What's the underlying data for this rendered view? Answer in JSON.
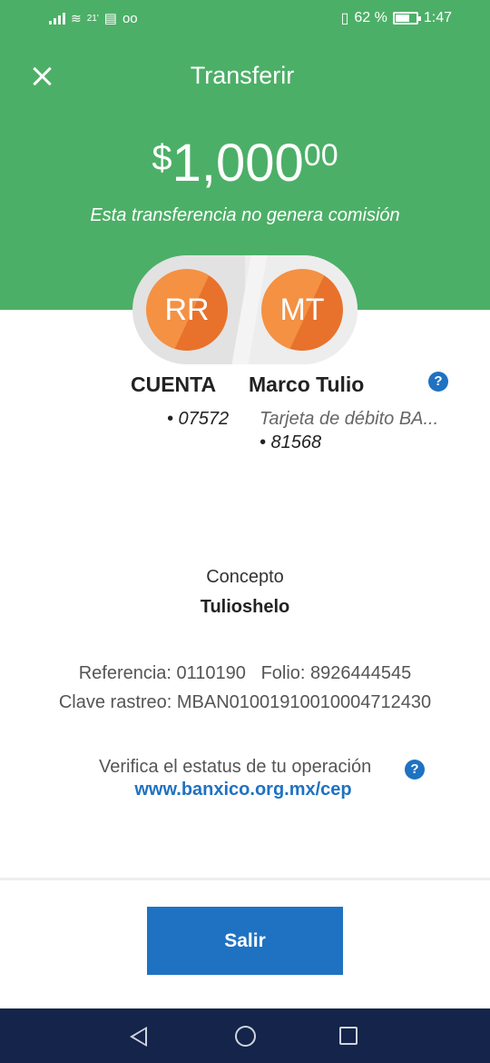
{
  "status_bar": {
    "left_small_text": "21'",
    "battery_percent": "62 %",
    "battery_level": 0.62,
    "time": "1:47",
    "icons": [
      "signal-icon",
      "wifi-icon",
      "message-icon",
      "voicemail-icon",
      "vibrate-icon",
      "battery-icon"
    ]
  },
  "header": {
    "title": "Transferir",
    "amount_currency": "$",
    "amount_main": "1,000",
    "amount_cents": "00",
    "subtitle": "Esta transferencia no genera comisión"
  },
  "from": {
    "initials": "RR",
    "label": "CUENTA",
    "account": "• 07572"
  },
  "to": {
    "initials": "MT",
    "name": "Marco Tulio",
    "account_type": "Tarjeta de débito BA...",
    "account": "• 81568"
  },
  "help_icon": "?",
  "concept": {
    "label": "Concepto",
    "value": "Tulioshelo"
  },
  "details": {
    "referencia_line": "Referencia: 0110190   Folio: 8926444545",
    "clave_line": "Clave rastreo: MBAN01001910010004712430"
  },
  "verify": {
    "text": "Verifica el estatus de tu operación",
    "link": "www.banxico.org.mx/cep"
  },
  "actions": {
    "exit_label": "Salir"
  },
  "colors": {
    "header_green": "#4caf67",
    "accent_blue": "#1f72c2",
    "avatar_orange": "#f49143",
    "navbar": "#14244a"
  }
}
